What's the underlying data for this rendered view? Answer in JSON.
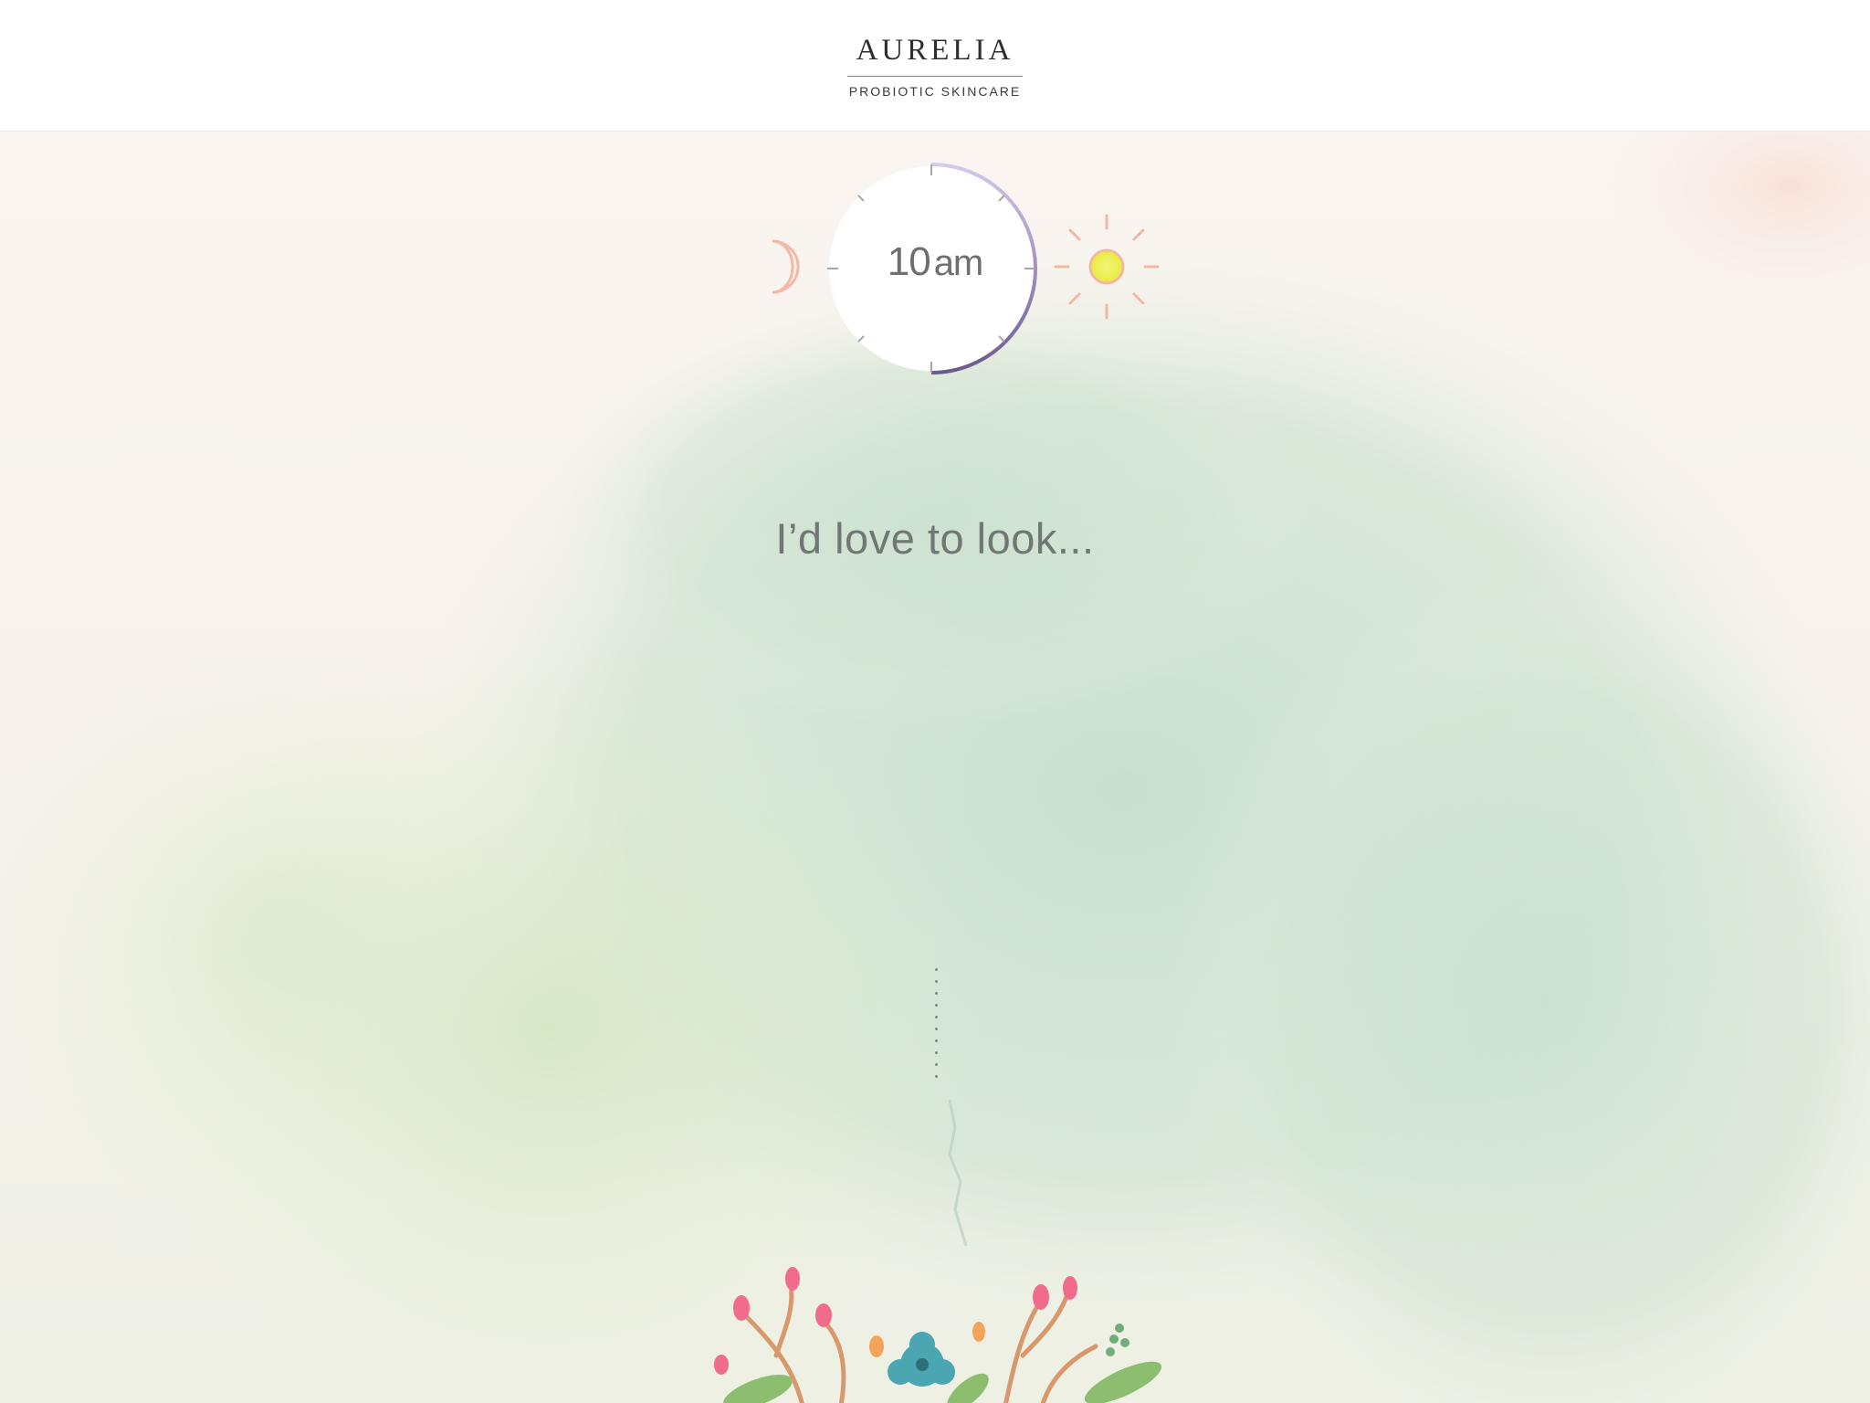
{
  "header": {
    "brand_name": "AURELIA",
    "brand_tagline": "PROBIOTIC SKINCARE"
  },
  "time_picker": {
    "hour": "10",
    "period": "am",
    "moon_icon": "moon-icon",
    "sun_icon": "sun-icon",
    "dial_progress": 0.5
  },
  "question": {
    "prompt": "I’d love to look..."
  },
  "colors": {
    "accent_purple": "#7a6a9c",
    "moon_peach": "#f3b9a4",
    "sun_yellow": "#f0f160",
    "watercolor_green": "#cfe3cf"
  }
}
